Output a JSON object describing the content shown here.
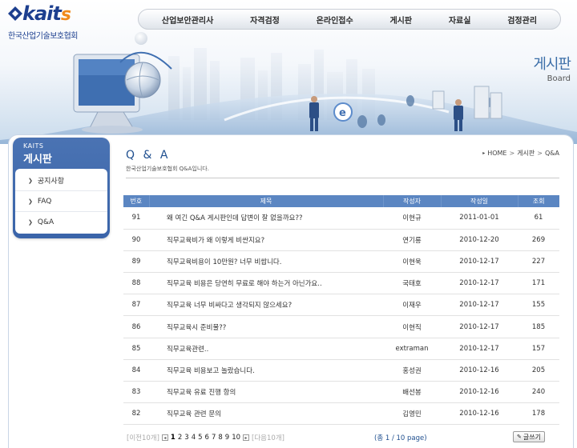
{
  "header": {
    "logo_text": "kait",
    "logo_s": "s",
    "logo_sub": "한국산업기술보호협회",
    "nav": [
      "산업보안관리사",
      "자격검정",
      "온라인접수",
      "게시판",
      "자료실",
      "검정관리"
    ],
    "page_title": "게시판",
    "page_title_eng": "Board"
  },
  "sidebar": {
    "head_eng": "KAITS",
    "head_kr": "게시판",
    "items": [
      "공지사항",
      "FAQ",
      "Q&A"
    ]
  },
  "content": {
    "title": "Q & A",
    "subtitle": "한국산업기술보호협회 Q&A입니다.",
    "breadcrumb": [
      "HOME",
      "게시판",
      "Q&A"
    ]
  },
  "table": {
    "headers": [
      "번호",
      "제목",
      "작성자",
      "작성일",
      "조회"
    ],
    "rows": [
      {
        "no": "91",
        "subject": "왜 여긴 Q&A 게시판인데 답변이 잘 없을까요??",
        "author": "이현규",
        "date": "2011-01-01",
        "hits": "61"
      },
      {
        "no": "90",
        "subject": "직무교육비가 왜 이렇게 비싼지요?",
        "author": "연기룡",
        "date": "2010-12-20",
        "hits": "269"
      },
      {
        "no": "89",
        "subject": "직무교육비용이 10만원? 너무 비쌉니다.",
        "author": "이현욱",
        "date": "2010-12-17",
        "hits": "227"
      },
      {
        "no": "88",
        "subject": "직무교육 비용은 당연히 무료로 해야 하는거 아닌가요..",
        "author": "국태호",
        "date": "2010-12-17",
        "hits": "171"
      },
      {
        "no": "87",
        "subject": "직무교육 너무 비싸다고 생각되지 않으세요?",
        "author": "이재우",
        "date": "2010-12-17",
        "hits": "155"
      },
      {
        "no": "86",
        "subject": "직무교육시 준비물??",
        "author": "이현직",
        "date": "2010-12-17",
        "hits": "185"
      },
      {
        "no": "85",
        "subject": "직무교육관련..",
        "author": "extraman",
        "date": "2010-12-17",
        "hits": "157"
      },
      {
        "no": "84",
        "subject": "직무교육 비용보고 놀랐습니다.",
        "author": "홍성권",
        "date": "2010-12-16",
        "hits": "205"
      },
      {
        "no": "83",
        "subject": "직무교육 유료 진행 항의",
        "author": "배선봉",
        "date": "2010-12-16",
        "hits": "240"
      },
      {
        "no": "82",
        "subject": "직무교육 관련 문의",
        "author": "김영민",
        "date": "2010-12-16",
        "hits": "178"
      }
    ]
  },
  "pager": {
    "prev": "[이전10개]",
    "pages": [
      "1",
      "2",
      "3",
      "4",
      "5",
      "6",
      "7",
      "8",
      "9",
      "10"
    ],
    "next": "[다음10개]",
    "info": "(총 1 / 10 page)",
    "write": "글쓰기"
  },
  "colors": {
    "accent": "#5b86c2",
    "sidebar": "#3a64a9",
    "title": "#1f4f8f",
    "logo_orange": "#f08a1c"
  }
}
